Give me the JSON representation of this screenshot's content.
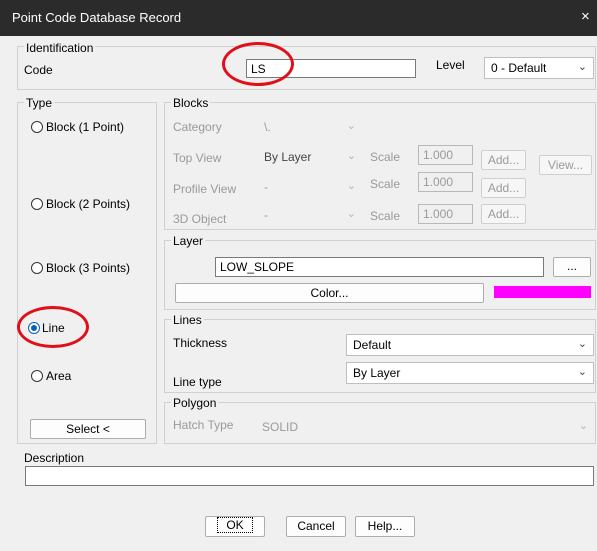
{
  "window": {
    "title": "Point Code Database Record",
    "close": "×"
  },
  "identification": {
    "group_label": "Identification",
    "code_label": "Code",
    "code_value": "LS",
    "level_label": "Level",
    "level_value": "0 - Default"
  },
  "type": {
    "group_label": "Type",
    "options": [
      "Block  (1 Point)",
      "Block (2 Points)",
      "Block (3 Points)",
      "Line",
      "Area"
    ],
    "selected": "Line",
    "select_button": "Select <"
  },
  "blocks": {
    "group_label": "Blocks",
    "category_label": "Category",
    "category_value": "\\.",
    "top_view_label": "Top View",
    "top_view_value": "By Layer",
    "profile_view_label": "Profile View",
    "profile_view_value": "-",
    "object3d_label": "3D Object",
    "object3d_value": "-",
    "scale_label": "Scale",
    "scale_values": [
      "1.000",
      "1.000",
      "1.000"
    ],
    "add_label": "Add...",
    "view_label": "View..."
  },
  "layer": {
    "group_label": "Layer",
    "value": "LOW_SLOPE",
    "browse_label": "...",
    "color_button": "Color...",
    "color": "#ff00ff"
  },
  "lines": {
    "group_label": "Lines",
    "thickness_label": "Thickness",
    "thickness_value": "Default",
    "linetype_label": "Line type",
    "linetype_value": "By Layer"
  },
  "polygon": {
    "group_label": "Polygon",
    "hatch_label": "Hatch Type",
    "hatch_value": "SOLID"
  },
  "description": {
    "label": "Description",
    "value": ""
  },
  "buttons": {
    "ok": "OK",
    "cancel": "Cancel",
    "help": "Help..."
  },
  "colors": {
    "highlight_circle": "#e0101a",
    "radio_selected": "#0a5db8"
  }
}
